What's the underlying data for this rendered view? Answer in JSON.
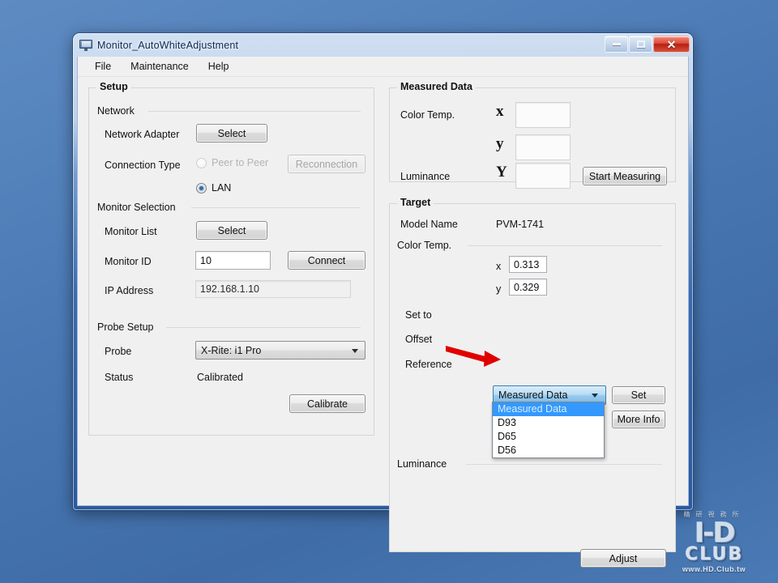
{
  "window": {
    "title": "Monitor_AutoWhiteAdjustment",
    "icon": "monitor-icon",
    "buttons": {
      "minimize": "minimize-icon",
      "maximize": "maximize-icon",
      "close": "✕"
    }
  },
  "menubar": {
    "items": [
      {
        "label": "File"
      },
      {
        "label": "Maintenance"
      },
      {
        "label": "Help"
      }
    ]
  },
  "setup": {
    "legend": "Setup",
    "network": {
      "label": "Network",
      "network_adapter_label": "Network Adapter",
      "network_adapter_button": "Select",
      "connection_type_label": "Connection Type",
      "peer_to_peer_label": "Peer to Peer",
      "reconnection_button": "Reconnection",
      "lan_label": "LAN",
      "selected": "LAN"
    },
    "monitor_selection": {
      "label": "Monitor Selection",
      "monitor_list_label": "Monitor List",
      "monitor_list_button": "Select",
      "monitor_id_label": "Monitor ID",
      "monitor_id_value": "10",
      "connect_button": "Connect",
      "ip_address_label": "IP Address",
      "ip_address_value": "192.168.1.10"
    },
    "probe_setup": {
      "label": "Probe Setup",
      "probe_label": "Probe",
      "probe_value": "X-Rite: i1 Pro",
      "status_label": "Status",
      "status_value": "Calibrated",
      "calibrate_button": "Calibrate"
    }
  },
  "measured_data": {
    "legend": "Measured Data",
    "color_temp_label": "Color Temp.",
    "luminance_label": "Luminance",
    "marker_x": "x",
    "marker_y": "y",
    "marker_Y": "Y",
    "value_x": "",
    "value_y": "",
    "value_Y": "",
    "start_measuring_button": "Start Measuring"
  },
  "target": {
    "legend": "Target",
    "model_name_label": "Model Name",
    "model_name_value": "PVM-1741",
    "color_temp_label": "Color Temp.",
    "x_label": "x",
    "x_value": "0.313",
    "y_label": "y",
    "y_value": "0.329",
    "set_to_label": "Set to",
    "set_to_value": "Measured Data",
    "set_button": "Set",
    "offset_label": "Offset",
    "more_info_button": "More Info",
    "reference_label": "Reference",
    "luminance_label": "Luminance",
    "adjust_button": "Adjust",
    "dropdown": {
      "open": true,
      "options": [
        {
          "label": "Measured Data",
          "selected": true
        },
        {
          "label": "D93",
          "selected": false
        },
        {
          "label": "D65",
          "selected": false
        },
        {
          "label": "D56",
          "selected": false
        }
      ]
    }
  },
  "annotation": {
    "arrow_color": "#e00000",
    "points_at": "D65"
  },
  "watermark": {
    "cjk": "精研視務所",
    "line1": "I-D",
    "line2": "CLUB",
    "url": "www.HD.Club.tw"
  },
  "colors": {
    "desktop": "#4a7ab5",
    "accent_blue": "#3399ff",
    "combo_focus_border": "#3c7fb1",
    "close_red": "#b51f14"
  }
}
